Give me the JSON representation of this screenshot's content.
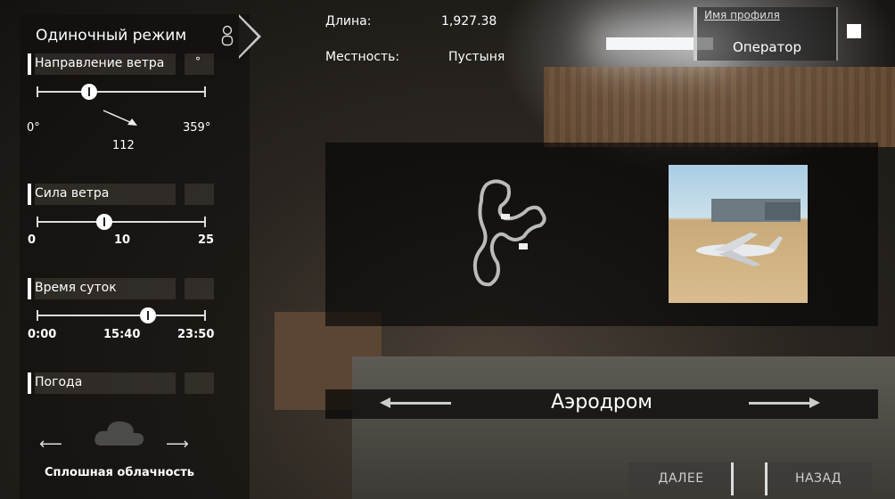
{
  "mode": {
    "label": "Одиночный режим",
    "icon": "person-icon"
  },
  "wind_direction": {
    "label": "Направление ветра",
    "unit": "°",
    "min": "0°",
    "max": "359°",
    "value": "112",
    "level": 0.31
  },
  "wind_strength": {
    "label": "Сила ветра",
    "min": "0",
    "mid": "10",
    "max": "25",
    "level": 0.4
  },
  "time_of_day": {
    "label": "Время суток",
    "min": "0:00",
    "value": "15:40",
    "max": "23:50",
    "level": 0.66
  },
  "weather": {
    "label": "Погода",
    "value": "Сплошная облачность",
    "icon": "cloud-icon"
  },
  "track_info": {
    "length_label": "Длина:",
    "length_value": "1,927.38",
    "terrain_label": "Местность:",
    "terrain_value": "Пустыня"
  },
  "profile": {
    "title": "Имя профиля",
    "name": "Оператор"
  },
  "track": {
    "name": "Аэродром"
  },
  "buttons": {
    "next": "ДАЛЕЕ",
    "back": "НАЗАД"
  }
}
